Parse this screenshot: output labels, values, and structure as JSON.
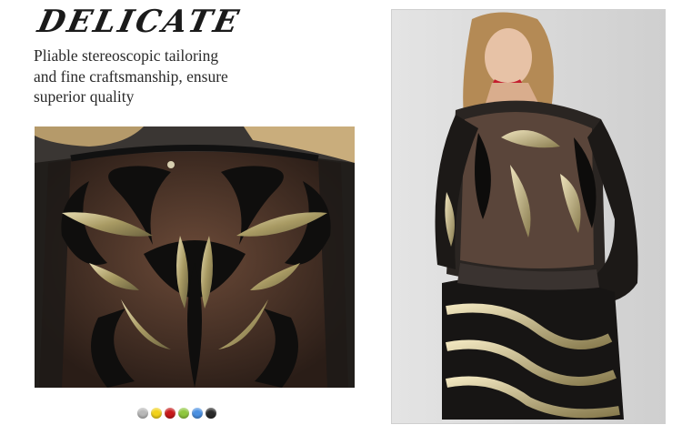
{
  "header": {
    "title": "DELICATE",
    "description_lines": [
      "Pliable stereoscopic tailoring",
      "and fine craftsmanship, ensure",
      "superior quality"
    ]
  },
  "images": {
    "closeup": {
      "subject": "sequin-back-closeup-photo"
    },
    "model": {
      "subject": "model-wearing-sequin-dress-photo"
    }
  },
  "colors": {
    "swatches": [
      "#b8b8b8",
      "#f2d21b",
      "#c81a1a",
      "#8fc73e",
      "#4a90e2",
      "#2a2a2a"
    ]
  }
}
